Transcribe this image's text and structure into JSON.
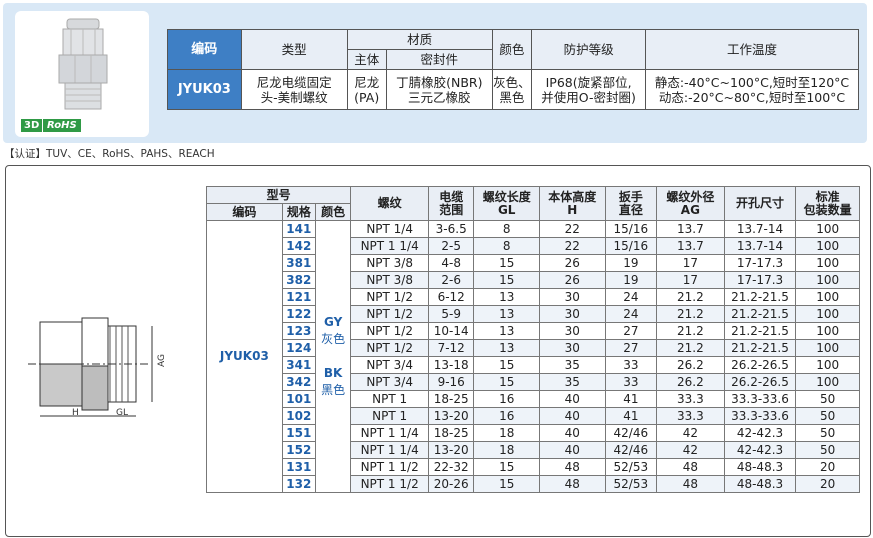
{
  "spec": {
    "headers": {
      "code": "编码",
      "type": "类型",
      "material": "材质",
      "body": "主体",
      "seal": "密封件",
      "color": "颜色",
      "protection": "防护等级",
      "temp": "工作温度"
    },
    "row": {
      "code": "JYUK03",
      "type_l1": "尼龙电缆固定",
      "type_l2": "头-美制螺纹",
      "body_l1": "尼龙",
      "body_l2": "(PA)",
      "seal_l1": "丁腈橡胶(NBR)",
      "seal_l2": "三元乙橡胶",
      "color_l1": "灰色、",
      "color_l2": "黑色",
      "protection_l1": "IP68(旋紧部位,",
      "protection_l2": "并使用O-密封圈)",
      "temp_l1": "静态:-40°C~100°C,短时至120°C",
      "temp_l2": "动态:-20°C~80°C,短时至100°C"
    },
    "badges": {
      "d3": "3D",
      "rohs": "RoHS"
    }
  },
  "certification": "【认证】TUV、CE、RoHS、PAHS、REACH",
  "drawing": {
    "label_ag": "AG",
    "label_h": "H",
    "label_gl": "GL"
  },
  "table": {
    "h_model": "型号",
    "h_code": "编码",
    "h_spec": "规格",
    "h_color": "颜色",
    "h_thread": "螺纹",
    "h_cable_1": "电缆",
    "h_cable_2": "范围",
    "h_gl_1": "螺纹长度",
    "h_gl_2": "GL",
    "h_h_1": "本体高度",
    "h_h_2": "H",
    "h_wrench_1": "扳手",
    "h_wrench_2": "直径",
    "h_ag_1": "螺纹外径",
    "h_ag_2": "AG",
    "h_hole": "开孔尺寸",
    "h_pack_1": "标准",
    "h_pack_2": "包装数量",
    "code": "JYUK03",
    "color_gy": "GY",
    "color_gy_cn": "灰色",
    "color_bk": "BK",
    "color_bk_cn": "黑色",
    "rows": [
      [
        "141",
        "NPT 1/4",
        "3-6.5",
        "8",
        "22",
        "15/16",
        "13.7",
        "13.7-14",
        "100"
      ],
      [
        "142",
        "NPT 1 1/4",
        "2-5",
        "8",
        "22",
        "15/16",
        "13.7",
        "13.7-14",
        "100"
      ],
      [
        "381",
        "NPT 3/8",
        "4-8",
        "15",
        "26",
        "19",
        "17",
        "17-17.3",
        "100"
      ],
      [
        "382",
        "NPT 3/8",
        "2-6",
        "15",
        "26",
        "19",
        "17",
        "17-17.3",
        "100"
      ],
      [
        "121",
        "NPT 1/2",
        "6-12",
        "13",
        "30",
        "24",
        "21.2",
        "21.2-21.5",
        "100"
      ],
      [
        "122",
        "NPT 1/2",
        "5-9",
        "13",
        "30",
        "24",
        "21.2",
        "21.2-21.5",
        "100"
      ],
      [
        "123",
        "NPT 1/2",
        "10-14",
        "13",
        "30",
        "27",
        "21.2",
        "21.2-21.5",
        "100"
      ],
      [
        "124",
        "NPT 1/2",
        "7-12",
        "13",
        "30",
        "27",
        "21.2",
        "21.2-21.5",
        "100"
      ],
      [
        "341",
        "NPT 3/4",
        "13-18",
        "15",
        "35",
        "33",
        "26.2",
        "26.2-26.5",
        "100"
      ],
      [
        "342",
        "NPT 3/4",
        "9-16",
        "15",
        "35",
        "33",
        "26.2",
        "26.2-26.5",
        "100"
      ],
      [
        "101",
        "NPT 1",
        "18-25",
        "16",
        "40",
        "41",
        "33.3",
        "33.3-33.6",
        "50"
      ],
      [
        "102",
        "NPT 1",
        "13-20",
        "16",
        "40",
        "41",
        "33.3",
        "33.3-33.6",
        "50"
      ],
      [
        "151",
        "NPT 1 1/4",
        "18-25",
        "18",
        "40",
        "42/46",
        "42",
        "42-42.3",
        "50"
      ],
      [
        "152",
        "NPT 1 1/4",
        "13-20",
        "18",
        "40",
        "42/46",
        "42",
        "42-42.3",
        "50"
      ],
      [
        "131",
        "NPT 1 1/2",
        "22-32",
        "15",
        "48",
        "52/53",
        "48",
        "48-48.3",
        "20"
      ],
      [
        "132",
        "NPT 1 1/2",
        "20-26",
        "15",
        "48",
        "52/53",
        "48",
        "48-48.3",
        "20"
      ]
    ]
  }
}
